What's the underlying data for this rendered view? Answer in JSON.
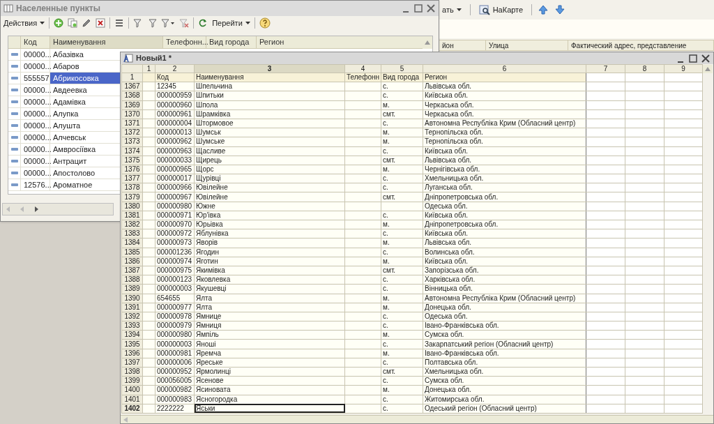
{
  "back_window": {
    "menu_label": "ать",
    "map_button": "НаКарте",
    "columns": [
      "йон",
      "Улица",
      "Фактический адрес, представление"
    ]
  },
  "list_window": {
    "title": "Населенные пункты",
    "actions_label": "Действия",
    "goto_label": "Перейти",
    "columns": [
      "Код",
      "Наименування",
      "Телефонн...",
      "Вид города",
      "Регион"
    ],
    "rows": [
      {
        "code": "00000...",
        "name": "Абазівка",
        "selected": false
      },
      {
        "code": "00000...",
        "name": "Абаров",
        "selected": false
      },
      {
        "code": "555557",
        "name": "Абрикосовка",
        "selected": true
      },
      {
        "code": "00000...",
        "name": "Авдеевка",
        "selected": false
      },
      {
        "code": "00000...",
        "name": "Адамівка",
        "selected": false
      },
      {
        "code": "00000...",
        "name": "Алупка",
        "selected": false
      },
      {
        "code": "00000...",
        "name": "Алушта",
        "selected": false
      },
      {
        "code": "00000...",
        "name": "Алчевськ",
        "selected": false
      },
      {
        "code": "00000...",
        "name": "Амвросіївка",
        "selected": false
      },
      {
        "code": "00000...",
        "name": "Антрацит",
        "selected": false
      },
      {
        "code": "00000...",
        "name": "Апостолово",
        "selected": false
      },
      {
        "code": "12576...",
        "name": "Ароматное",
        "selected": false
      }
    ]
  },
  "sheet_window": {
    "title": "Новый1 *",
    "column_numbers": [
      {
        "label": "1",
        "selected": false
      },
      {
        "label": "2",
        "selected": false
      },
      {
        "label": "3",
        "selected": true
      },
      {
        "label": "4",
        "selected": false
      },
      {
        "label": "5",
        "selected": false
      },
      {
        "label": "6",
        "selected": false
      },
      {
        "label": "7",
        "selected": false
      },
      {
        "label": "8",
        "selected": false
      },
      {
        "label": "9",
        "selected": false
      }
    ],
    "rows": [
      {
        "kind": "header",
        "number": "1",
        "code": "Код",
        "name": "Наименування",
        "phone": "Телефонн",
        "type": "Вид города",
        "region": "Регион",
        "selected": false
      },
      {
        "kind": "data",
        "number": "1367",
        "code": "12345",
        "name": "Шпельчина",
        "type": "с.",
        "region": "Львівська обл.",
        "selected": false
      },
      {
        "kind": "data",
        "number": "1368",
        "code": "000000959",
        "name": "Шпитьки",
        "type": "с.",
        "region": "Київська обл.",
        "selected": false
      },
      {
        "kind": "data",
        "number": "1369",
        "code": "000000960",
        "name": "Шпола",
        "type": "м.",
        "region": "Черкаська обл.",
        "selected": false
      },
      {
        "kind": "data",
        "number": "1370",
        "code": "000000961",
        "name": "Шрамківка",
        "type": "смт.",
        "region": "Черкаська обл.",
        "selected": false
      },
      {
        "kind": "data",
        "number": "1371",
        "code": "000000004",
        "name": "Штормовое",
        "type": "с.",
        "region": "Автономна Республіка Крим (Обласний центр)",
        "selected": false
      },
      {
        "kind": "data",
        "number": "1372",
        "code": "000000013",
        "name": "Шумськ",
        "type": "м.",
        "region": "Тернопільска обл.",
        "selected": false
      },
      {
        "kind": "data",
        "number": "1373",
        "code": "000000962",
        "name": "Шумське",
        "type": "м.",
        "region": "Тернопільска обл.",
        "selected": false
      },
      {
        "kind": "data",
        "number": "1374",
        "code": "000000963",
        "name": "Щасливе",
        "type": "с.",
        "region": "Київська обл.",
        "selected": false
      },
      {
        "kind": "data",
        "number": "1375",
        "code": "000000033",
        "name": "Щирець",
        "type": "смт.",
        "region": "Львівська обл.",
        "selected": false
      },
      {
        "kind": "data",
        "number": "1376",
        "code": "000000965",
        "name": "Щорс",
        "type": "м.",
        "region": "Чернігівська обл.",
        "selected": false
      },
      {
        "kind": "data",
        "number": "1377",
        "code": "000000017",
        "name": "Щурівці",
        "type": "с.",
        "region": "Хмельницька обл.",
        "selected": false
      },
      {
        "kind": "data",
        "number": "1378",
        "code": "000000966",
        "name": "Ювілейне",
        "type": "с.",
        "region": "Луганська обл.",
        "selected": false
      },
      {
        "kind": "data",
        "number": "1379",
        "code": "000000967",
        "name": "Ювілейне",
        "type": "смт.",
        "region": "Дніпропетровська обл.",
        "selected": false
      },
      {
        "kind": "data",
        "number": "1380",
        "code": "000000980",
        "name": "Южне",
        "region": "Одеська обл.",
        "selected": false
      },
      {
        "kind": "data",
        "number": "1381",
        "code": "000000971",
        "name": "Юр'івка",
        "type": "с.",
        "region": "Київська обл.",
        "selected": false
      },
      {
        "kind": "data",
        "number": "1382",
        "code": "000000970",
        "name": "Юрьівка",
        "type": "м.",
        "region": "Дніпропетровська обл.",
        "selected": false
      },
      {
        "kind": "data",
        "number": "1383",
        "code": "000000972",
        "name": "Яблунівка",
        "type": "с.",
        "region": "Київська обл.",
        "selected": false
      },
      {
        "kind": "data",
        "number": "1384",
        "code": "000000973",
        "name": "Яворів",
        "type": "м.",
        "region": "Львівська обл.",
        "selected": false
      },
      {
        "kind": "data",
        "number": "1385",
        "code": "000001236",
        "name": "Ягодин",
        "type": "с.",
        "region": "Волинська обл.",
        "selected": false
      },
      {
        "kind": "data",
        "number": "1386",
        "code": "000000974",
        "name": "Яготин",
        "type": "м.",
        "region": "Київська обл.",
        "selected": false
      },
      {
        "kind": "data",
        "number": "1387",
        "code": "000000975",
        "name": "Якимівка",
        "type": "смт.",
        "region": "Запорізська обл.",
        "selected": false
      },
      {
        "kind": "data",
        "number": "1388",
        "code": "000000123",
        "name": "Яковлевка",
        "type": "с.",
        "region": "Харківська обл.",
        "selected": false
      },
      {
        "kind": "data",
        "number": "1389",
        "code": "000000003",
        "name": "Якушевці",
        "type": "с.",
        "region": "Вінницька обл.",
        "selected": false
      },
      {
        "kind": "data",
        "number": "1390",
        "code": "654655",
        "name": "Ялта",
        "type": "м.",
        "region": "Автономна Республіка Крим (Обласний центр)",
        "selected": false
      },
      {
        "kind": "data",
        "number": "1391",
        "code": "000000977",
        "name": "Ялта",
        "type": "м.",
        "region": "Донецька обл.",
        "selected": false
      },
      {
        "kind": "data",
        "number": "1392",
        "code": "000000978",
        "name": "Ямнице",
        "type": "с.",
        "region": "Одеська обл.",
        "selected": false
      },
      {
        "kind": "data",
        "number": "1393",
        "code": "000000979",
        "name": "Ямниця",
        "type": "с.",
        "region": "Івано-Франківська обл.",
        "selected": false
      },
      {
        "kind": "data",
        "number": "1394",
        "code": "000000980",
        "name": "Ямпіль",
        "type": "м.",
        "region": "Сумска обл.",
        "selected": false
      },
      {
        "kind": "data",
        "number": "1395",
        "code": "000000003",
        "name": "Яноші",
        "type": "с.",
        "region": "Закарпатський регіон (Обласний центр)",
        "selected": false
      },
      {
        "kind": "data",
        "number": "1396",
        "code": "000000981",
        "name": "Яремча",
        "type": "м.",
        "region": "Івано-Франківська обл.",
        "selected": false
      },
      {
        "kind": "data",
        "number": "1397",
        "code": "000000006",
        "name": "Яреське",
        "type": "с.",
        "region": "Полтавська обл.",
        "selected": false
      },
      {
        "kind": "data",
        "number": "1398",
        "code": "000000952",
        "name": "Ярмолинці",
        "type": "смт.",
        "region": "Хмельницька обл.",
        "selected": false
      },
      {
        "kind": "data",
        "number": "1399",
        "code": "000056005",
        "name": "Ясенове",
        "type": "с.",
        "region": "Сумска обл.",
        "selected": false
      },
      {
        "kind": "data",
        "number": "1400",
        "code": "000000982",
        "name": "Ясиновата",
        "type": "м.",
        "region": "Донецька обл.",
        "selected": false
      },
      {
        "kind": "data",
        "number": "1401",
        "code": "000000983",
        "name": "Ясногородка",
        "type": "с.",
        "region": "Житомирська обл.",
        "selected": false
      },
      {
        "kind": "data",
        "number": "1402",
        "code": "2222222",
        "name": "Яськи",
        "type": "с.",
        "region": "Одеський регіон (Обласний центр)",
        "selected": true
      }
    ]
  }
}
